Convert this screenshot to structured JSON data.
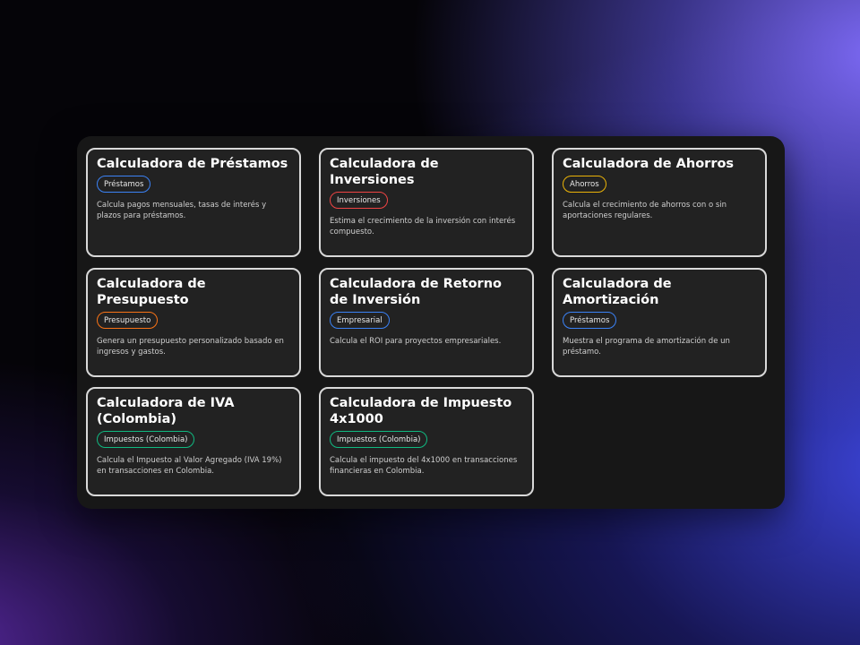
{
  "cards": [
    {
      "title": "Calculadora de Préstamos",
      "badge": "Préstamos",
      "badge_color": "#3b82f6",
      "description": "Calcula pagos mensuales, tasas de interés y plazos para préstamos."
    },
    {
      "title": "Calculadora de Inversiones",
      "badge": "Inversiones",
      "badge_color": "#ef4444",
      "description": "Estima el crecimiento de la inversión con interés compuesto."
    },
    {
      "title": "Calculadora de Ahorros",
      "badge": "Ahorros",
      "badge_color": "#eab308",
      "description": "Calcula el crecimiento de ahorros con o sin aportaciones regulares."
    },
    {
      "title": "Calculadora de Presupuesto",
      "badge": "Presupuesto",
      "badge_color": "#f97316",
      "description": "Genera un presupuesto personalizado basado en ingresos y gastos."
    },
    {
      "title": "Calculadora de Retorno de Inversión",
      "badge": "Empresarial",
      "badge_color": "#3b82f6",
      "description": "Calcula el ROI para proyectos empresariales."
    },
    {
      "title": "Calculadora de Amortización",
      "badge": "Préstamos",
      "badge_color": "#3b82f6",
      "description": "Muestra el programa de amortización de un préstamo."
    },
    {
      "title": "Calculadora de IVA (Colombia)",
      "badge": "Impuestos (Colombia)",
      "badge_color": "#10b981",
      "description": "Calcula el Impuesto al Valor Agregado (IVA 19%) en transacciones en Colombia."
    },
    {
      "title": "Calculadora de Impuesto 4x1000",
      "badge": "Impuestos (Colombia)",
      "badge_color": "#10b981",
      "description": "Calcula el impuesto del 4x1000 en transacciones financieras en Colombia."
    }
  ]
}
